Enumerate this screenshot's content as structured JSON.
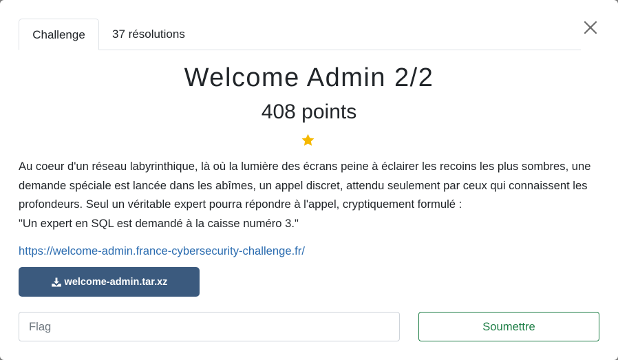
{
  "tabs": [
    {
      "label": "Challenge",
      "active": true
    },
    {
      "label": "37 résolutions",
      "active": false
    }
  ],
  "challenge": {
    "title": "Welcome Admin 2/2",
    "points": "408 points",
    "stars": 1,
    "description": [
      "Au coeur d'un réseau labyrinthique, là où la lumière des écrans peine à éclairer les recoins les plus sombres, une demande spéciale est lancée dans les abîmes, un appel discret, attendu seulement par ceux qui connaissent les profondeurs. Seul un véritable expert pourra répondre à l'appel, cryptiquement formulé :",
      "\"Un expert en SQL est demandé à la caisse numéro 3.\""
    ],
    "link": "https://welcome-admin.france-cybersecurity-challenge.fr/",
    "download_label": "welcome-admin.tar.xz"
  },
  "form": {
    "flag_placeholder": "Flag",
    "flag_value": "",
    "submit_label": "Soumettre"
  },
  "icons": {
    "close": "close-icon",
    "star": "star-icon",
    "download": "download-icon"
  },
  "colors": {
    "star": "#f5b800",
    "download_button": "#3b5a7e",
    "submit_border": "#1e7e46",
    "link": "#2b6cb0"
  }
}
